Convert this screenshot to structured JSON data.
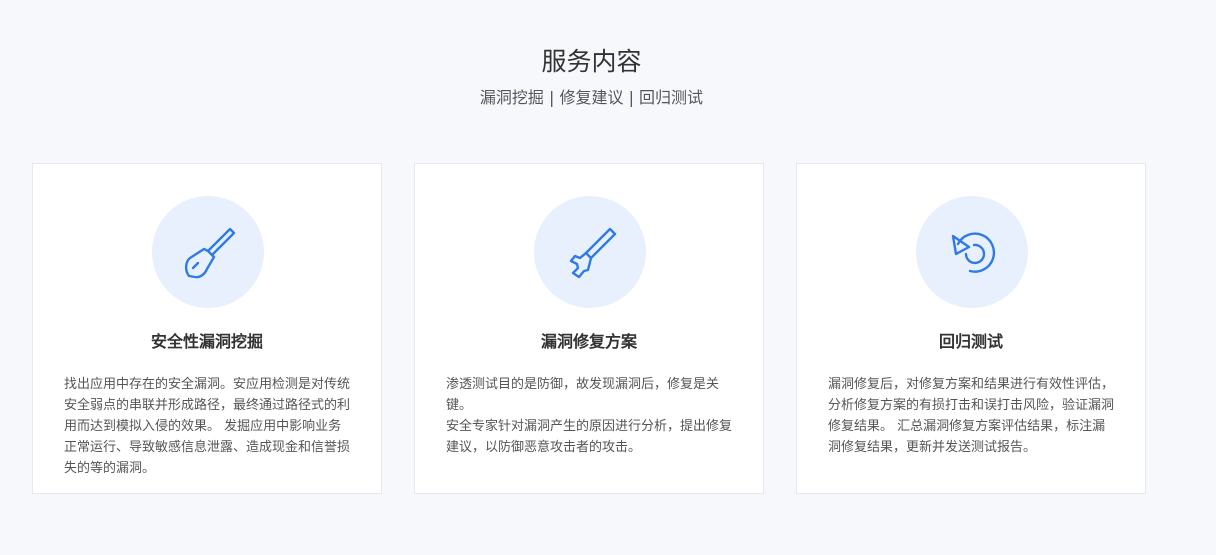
{
  "section": {
    "title": "服务内容",
    "subtitle": "漏洞挖掘 | 修复建议 | 回归测试"
  },
  "theme": {
    "accent": "#2f7be5",
    "icon_bg": "#e8f0fe",
    "page_bg": "#f7f8fc",
    "card_border": "#e6e8ee"
  },
  "cards": [
    {
      "icon": "shovel-icon",
      "title": "安全性漏洞挖掘",
      "paragraphs": [
        "找出应用中存在的安全漏洞。安应用检测是对传统安全弱点的串联并形成路径，最终通过路径式的利用而达到模拟入侵的效果。 发掘应用中影响业务正常运行、导致敏感信息泄露、造成现金和信誉损失的等的漏洞。"
      ]
    },
    {
      "icon": "wrench-icon",
      "title": "漏洞修复方案",
      "paragraphs": [
        "渗透测试目的是防御，故发现漏洞后，修复是关键。",
        "安全专家针对漏洞产生的原因进行分析，提出修复建议，以防御恶意攻击者的攻击。"
      ]
    },
    {
      "icon": "refresh-icon",
      "title": "回归测试",
      "paragraphs": [
        "漏洞修复后，对修复方案和结果进行有效性评估，分析修复方案的有损打击和误打击风险，验证漏洞修复结果。 汇总漏洞修复方案评估结果，标注漏洞修复结果，更新并发送测试报告。"
      ]
    }
  ]
}
